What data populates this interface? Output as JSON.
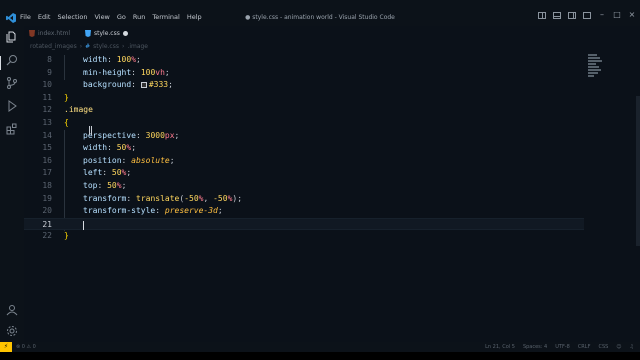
{
  "menu": [
    "File",
    "Edit",
    "Selection",
    "View",
    "Go",
    "Run",
    "Terminal",
    "Help"
  ],
  "window_title": "● style.css - animation world - Visual Studio Code",
  "tabs": [
    {
      "label": "index.html",
      "icon": "html5-icon",
      "active": false
    },
    {
      "label": "style.css",
      "icon": "css3-icon",
      "active": true,
      "dirty": true
    }
  ],
  "breadcrumb": [
    "rotated_images",
    "#",
    "style.css",
    ".image"
  ],
  "code_lines": [
    {
      "n": "8",
      "prop": "width",
      "num": "100",
      "unit": "%"
    },
    {
      "n": "9",
      "prop": "min-height",
      "num": "100",
      "unit": "vh"
    },
    {
      "n": "10",
      "prop": "background",
      "color": "#333"
    },
    {
      "n": "11",
      "text": "}"
    },
    {
      "n": "12",
      "text": ".image"
    },
    {
      "n": "13",
      "text": "{"
    },
    {
      "n": "14",
      "prop": "perspective",
      "num": "3000",
      "unit": "px"
    },
    {
      "n": "15",
      "prop": "width",
      "num": "50",
      "unit": "%"
    },
    {
      "n": "16",
      "prop": "position",
      "val": "absolute"
    },
    {
      "n": "17",
      "prop": "left",
      "num": "50",
      "unit": "%"
    },
    {
      "n": "18",
      "prop": "top",
      "num": "50",
      "unit": "%"
    },
    {
      "n": "19",
      "prop": "transform",
      "fn": "translate",
      "a1": "-50",
      "a2": "-50"
    },
    {
      "n": "20",
      "prop": "transform-style",
      "val": "preserve-3d"
    },
    {
      "n": "21",
      "text": ""
    },
    {
      "n": "22",
      "text": "}"
    }
  ],
  "status": {
    "problems": "⊗ 0 ⚠ 0",
    "position": "Ln 21, Col 5",
    "spaces": "Spaces: 4",
    "encoding": "UTF-8",
    "eol": "CRLF",
    "language": "CSS",
    "remote_icon": "remote-icon"
  },
  "colors": {
    "background": "#0b1119",
    "property": "#b6e0ff",
    "number": "#ffd75e",
    "unit": "#ff7b8f",
    "value": "#ffbf40",
    "remote": "#ffc400"
  }
}
